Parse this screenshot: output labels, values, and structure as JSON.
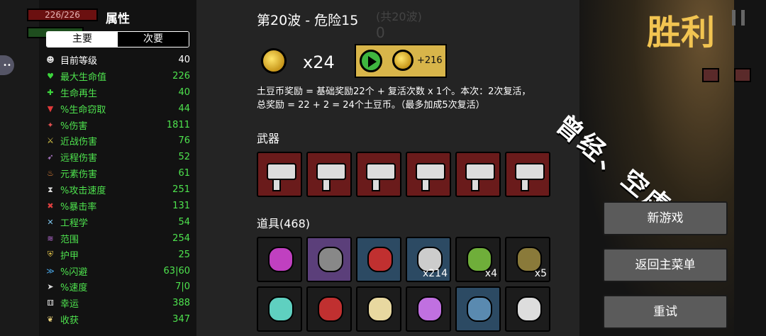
{
  "hud": {
    "hp_text": "226/226"
  },
  "attributes": {
    "title": "属性",
    "tabs": [
      "主要",
      "次要"
    ],
    "stats": [
      {
        "icon": "level-icon",
        "name": "目前等级",
        "value": "40",
        "color": "white"
      },
      {
        "icon": "heart-icon",
        "name": "最大生命值",
        "value": "226",
        "color": "green"
      },
      {
        "icon": "regen-icon",
        "name": "生命再生",
        "value": "40",
        "color": "green"
      },
      {
        "icon": "lifesteal-icon",
        "name": "%生命窃取",
        "value": "44",
        "color": "green"
      },
      {
        "icon": "damage-icon",
        "name": "%伤害",
        "value": "1811",
        "color": "green"
      },
      {
        "icon": "melee-icon",
        "name": "近战伤害",
        "value": "76",
        "color": "green"
      },
      {
        "icon": "ranged-icon",
        "name": "远程伤害",
        "value": "52",
        "color": "green"
      },
      {
        "icon": "elemental-icon",
        "name": "元素伤害",
        "value": "61",
        "color": "green"
      },
      {
        "icon": "hourglass-icon",
        "name": "%攻击速度",
        "value": "251",
        "color": "green"
      },
      {
        "icon": "crit-icon",
        "name": "%暴击率",
        "value": "131",
        "color": "green"
      },
      {
        "icon": "engineering-icon",
        "name": "工程学",
        "value": "54",
        "color": "green"
      },
      {
        "icon": "range-icon",
        "name": "范围",
        "value": "254",
        "color": "green"
      },
      {
        "icon": "armor-icon",
        "name": "护甲",
        "value": "25",
        "color": "green"
      },
      {
        "icon": "dodge-icon",
        "name": "%闪避",
        "value": "63|60",
        "color": "green"
      },
      {
        "icon": "speed-icon",
        "name": "%速度",
        "value": "7|0",
        "color": "green"
      },
      {
        "icon": "luck-icon",
        "name": "幸运",
        "value": "388",
        "color": "green"
      },
      {
        "icon": "harvest-icon",
        "name": "收获",
        "value": "347",
        "color": "green"
      }
    ]
  },
  "wave": {
    "title": "第20波 - 危险15",
    "total": "(共20波)",
    "zero": "0",
    "coin_count": "x24",
    "reward_amount": "+216",
    "description_line1": "土豆币奖励 = 基础奖励22个 + 复活次数 x 1个。本次：2次复活，",
    "description_line2": "总奖励 = 22 + 2 = 24个土豆币。（最多加成5次复活）"
  },
  "weapons": {
    "label": "武器",
    "items": [
      "megaphone-gun-icon",
      "megaphone-gun-icon",
      "megaphone-gun-icon",
      "megaphone-gun-icon",
      "megaphone-gun-icon",
      "megaphone-gun-icon"
    ]
  },
  "items": {
    "label": "道具(468)",
    "row1": [
      {
        "icon": "tentacle-icon",
        "count": "",
        "bg": "dark"
      },
      {
        "icon": "shield-net-icon",
        "count": "",
        "bg": "purple"
      },
      {
        "icon": "potato-face-icon",
        "count": "",
        "bg": "blue"
      },
      {
        "icon": "cable-icon",
        "count": "x214",
        "bg": "blue"
      },
      {
        "icon": "tree-icon",
        "count": "x4",
        "bg": "dark"
      },
      {
        "icon": "hood-icon",
        "count": "x5",
        "bg": "dark"
      }
    ],
    "row2": [
      {
        "icon": "ghost-icon",
        "bg": "dark"
      },
      {
        "icon": "claw-icon",
        "bg": "dark"
      },
      {
        "icon": "lizard-icon",
        "bg": "dark"
      },
      {
        "icon": "rocket-icon",
        "bg": "dark"
      },
      {
        "icon": "crab-icon",
        "bg": "blue"
      },
      {
        "icon": "mummy-icon",
        "bg": "dark"
      }
    ]
  },
  "result": {
    "title": "胜利"
  },
  "watermark": "曾经、空虚",
  "menu": {
    "new_game": "新游戏",
    "main_menu": "返回主菜单",
    "retry": "重试"
  }
}
